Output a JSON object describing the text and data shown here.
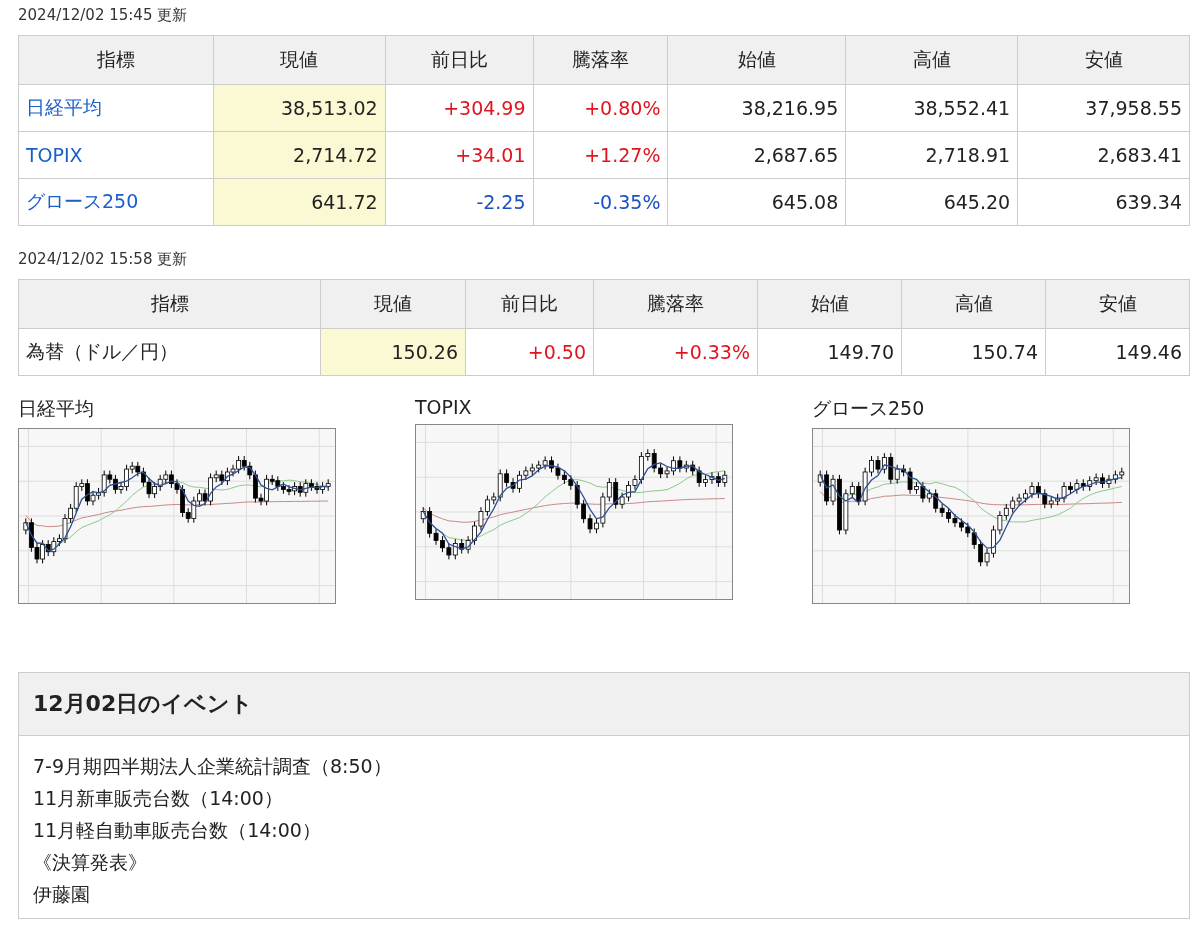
{
  "stock_table": {
    "updated": "2024/12/02 15:45 更新",
    "columns": [
      "指標",
      "現値",
      "前日比",
      "騰落率",
      "始値",
      "高値",
      "安値"
    ],
    "rows": [
      {
        "name": "日経平均",
        "link": true,
        "color": "#e0141e",
        "price": "38,513.02",
        "change": "+304.99",
        "rate": "+0.80%",
        "open": "38,216.95",
        "high": "38,552.41",
        "low": "37,958.55"
      },
      {
        "name": "TOPIX",
        "link": true,
        "color": "#e0141e",
        "price": "2,714.72",
        "change": "+34.01",
        "rate": "+1.27%",
        "open": "2,687.65",
        "high": "2,718.91",
        "low": "2,683.41"
      },
      {
        "name": "グロース250",
        "link": true,
        "color": "#1a4fc8",
        "price": "641.72",
        "change": "-2.25",
        "rate": "-0.35%",
        "open": "645.08",
        "high": "645.20",
        "low": "639.34"
      }
    ]
  },
  "fx_table": {
    "updated": "2024/12/02 15:58 更新",
    "columns": [
      "指標",
      "現値",
      "前日比",
      "騰落率",
      "始値",
      "高値",
      "安値"
    ],
    "rows": [
      {
        "name": "為替（ドル／円）",
        "link": false,
        "color": "#e0141e",
        "price": "150.26",
        "change": "+0.50",
        "rate": "+0.33%",
        "open": "149.70",
        "high": "150.74",
        "low": "149.46"
      }
    ]
  },
  "charts": [
    {
      "title": "日経平均"
    },
    {
      "title": "TOPIX"
    },
    {
      "title": "グロース250"
    }
  ],
  "events": {
    "title": "12月02日のイベント",
    "items": [
      "7-9月期四半期法人企業統計調査（8:50）",
      "11月新車販売台数（14:00）",
      "11月軽自動車販売台数（14:00）",
      "《決算発表》",
      "伊藤園"
    ]
  }
}
